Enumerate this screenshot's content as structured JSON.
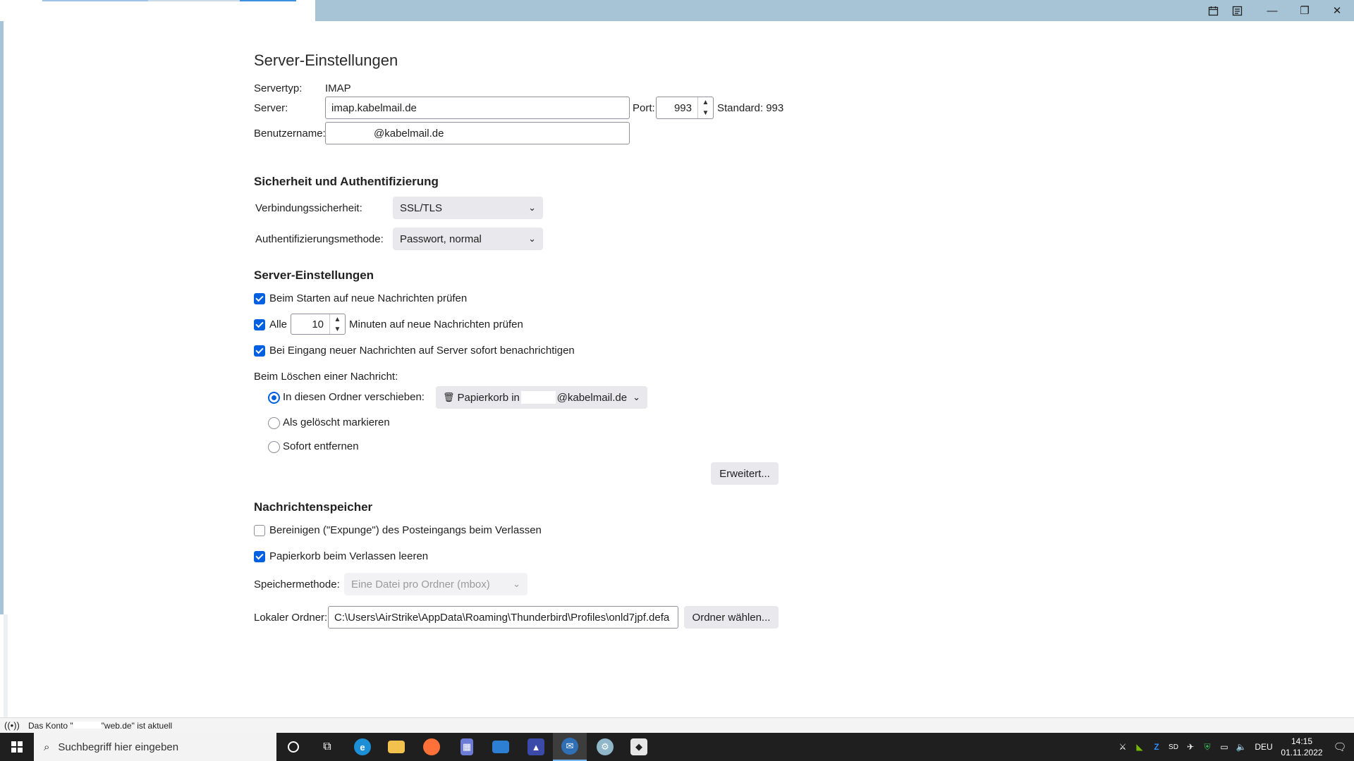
{
  "window": {
    "controls": {
      "minimize": "—",
      "maximize": "❐",
      "close": "✕"
    }
  },
  "server_settings": {
    "title": "Server-Einstellungen",
    "server_type_label": "Servertyp:",
    "server_type_value": "IMAP",
    "server_label": "Server:",
    "server_value": "imap.kabelmail.de",
    "port_label": "Port:",
    "port_value": "993",
    "standard_label": "Standard: 993",
    "username_label": "Benutzername:",
    "username_value": "@kabelmail.de"
  },
  "security": {
    "heading": "Sicherheit und Authentifizierung",
    "connection_label": "Verbindungssicherheit:",
    "connection_value": "SSL/TLS",
    "auth_label": "Authentifizierungsmethode:",
    "auth_value": "Passwort, normal"
  },
  "server_options": {
    "heading": "Server-Einstellungen",
    "check_on_start": {
      "label": "Beim Starten auf neue Nachrichten prüfen",
      "checked": true
    },
    "check_every": {
      "label_before": "Alle",
      "minutes": "10",
      "label_after": "Minuten auf neue Nachrichten prüfen",
      "checked": true
    },
    "push_notify": {
      "label": "Bei Eingang neuer Nachrichten auf Server sofort benachrichtigen",
      "checked": true
    },
    "delete_label": "Beim Löschen einer Nachricht:",
    "delete_options": [
      {
        "label": "In diesen Ordner verschieben:",
        "selected": true
      },
      {
        "label": "Als gelöscht markieren",
        "selected": false
      },
      {
        "label": "Sofort entfernen",
        "selected": false
      }
    ],
    "trash_folder_prefix": "Papierkorb in",
    "trash_folder_suffix": "@kabelmail.de",
    "advanced_button": "Erweitert..."
  },
  "storage": {
    "heading": "Nachrichtenspeicher",
    "expunge": {
      "label": "Bereinigen (\"Expunge\") des Posteingangs beim Verlassen",
      "checked": false
    },
    "empty_trash": {
      "label": "Papierkorb beim Verlassen leeren",
      "checked": true
    },
    "method_label": "Speichermethode:",
    "method_value": "Eine Datei pro Ordner (mbox)",
    "local_folder_label": "Lokaler Ordner:",
    "local_folder_value": "C:\\Users\\AirStrike\\AppData\\Roaming\\Thunderbird\\Profiles\\onld7jpf.defa",
    "choose_folder_button": "Ordner wählen..."
  },
  "statusbar": {
    "text_prefix": "Das Konto \"",
    "text_suffix": "\"web.de\" ist aktuell"
  },
  "taskbar": {
    "search_placeholder": "Suchbegriff hier eingeben",
    "tray_lang": "DEU",
    "time": "14:15",
    "date": "01.11.2022"
  },
  "colors": {
    "titlebar": "#a7c4d6",
    "accent": "#0060df",
    "taskbar": "#1f1f1f"
  }
}
